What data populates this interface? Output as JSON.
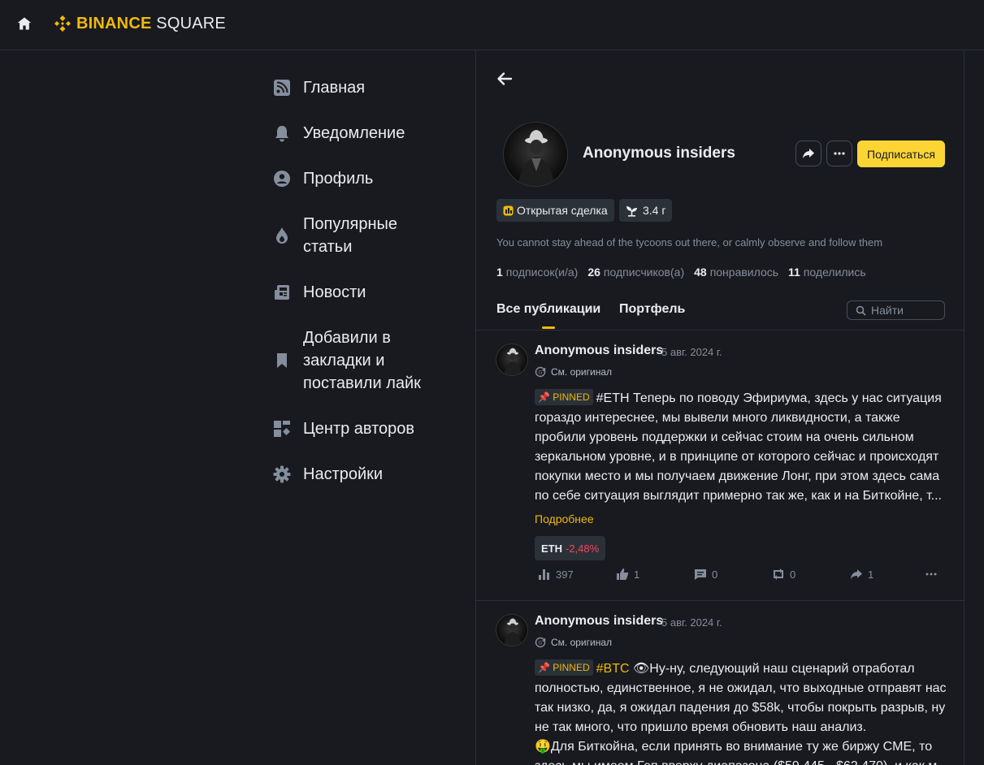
{
  "header": {
    "logo_binance": "BINANCE",
    "logo_square": "SQUARE"
  },
  "sidebar": {
    "items": [
      {
        "label": "Главная",
        "icon": "feed-icon"
      },
      {
        "label": "Уведомление",
        "icon": "bell-icon"
      },
      {
        "label": "Профиль",
        "icon": "user-icon"
      },
      {
        "label": "Популярные статьи",
        "icon": "flame-icon"
      },
      {
        "label": "Новости",
        "icon": "news-icon"
      },
      {
        "label": "Добавили в закладки и поставили лайк",
        "icon": "bookmark-icon"
      },
      {
        "label": "Центр авторов",
        "icon": "dashboard-icon"
      },
      {
        "label": "Настройки",
        "icon": "gear-icon"
      }
    ]
  },
  "profile": {
    "name": "Anonymous insiders",
    "follow_label": "Подписаться",
    "tags": [
      {
        "label": "Открытая сделка",
        "icon": "trade-icon"
      },
      {
        "label": "3.4 г",
        "icon": "sprout-icon"
      }
    ],
    "bio": "You cannot stay ahead of the tycoons out there, or calmly observe and follow them",
    "stats": [
      {
        "num": "1",
        "label": "подписок(и/а)"
      },
      {
        "num": "26",
        "label": "подписчиков(а)"
      },
      {
        "num": "48",
        "label": "понравилось"
      },
      {
        "num": "11",
        "label": "поделились"
      }
    ],
    "tabs": [
      "Все публикации",
      "Портфель"
    ],
    "search_placeholder": "Найти"
  },
  "posts": [
    {
      "author": "Anonymous insiders",
      "date": "5 авг. 2024 г.",
      "original_label": "См. оригинал",
      "pinned_label": "PINNED",
      "hashtag": "#ETH",
      "text": " Теперь по поводу Эфириума, здесь у нас ситуация гораздо интереснее, мы вывели много ликвидности, а также пробили уровень поддержки и сейчас стоим на очень сильном зеркальном уровне, и в принципе от которого сейчас и происходят покупки место и мы получаем движение Лонг, при этом здесь сама по себе ситуация выглядит примерно так же, как и на Биткойне, т...",
      "more_label": "Подробнее",
      "coin_symbol": "ETH",
      "coin_change": "-2,48%",
      "views": "397",
      "likes": "1",
      "comments": "0",
      "reposts": "0",
      "shares": "1"
    },
    {
      "author": "Anonymous insiders",
      "date": "5 авг. 2024 г.",
      "original_label": "См. оригинал",
      "pinned_label": "PINNED",
      "hashtag": "#BTC",
      "text": " 👁Ну-ну, следующий наш сценарий отработал полностью, единственное, я не ожидал, что выходные отправят нас так низко, да, я ожидал падения до $58k, чтобы покрыть разрыв, ну не так много, что пришло время обновить наш анализ.",
      "text2": "🤑Для Биткойна, если принять во внимание ту же биржу CME, то здесь мы имеем Гэп вверху диапазона ($59,445 - $62,470), и как м"
    }
  ],
  "colors": {
    "background": "#181a20",
    "accent": "#f0b90b",
    "button": "#fcd535",
    "negative": "#f6465d",
    "muted": "#848e9c"
  }
}
